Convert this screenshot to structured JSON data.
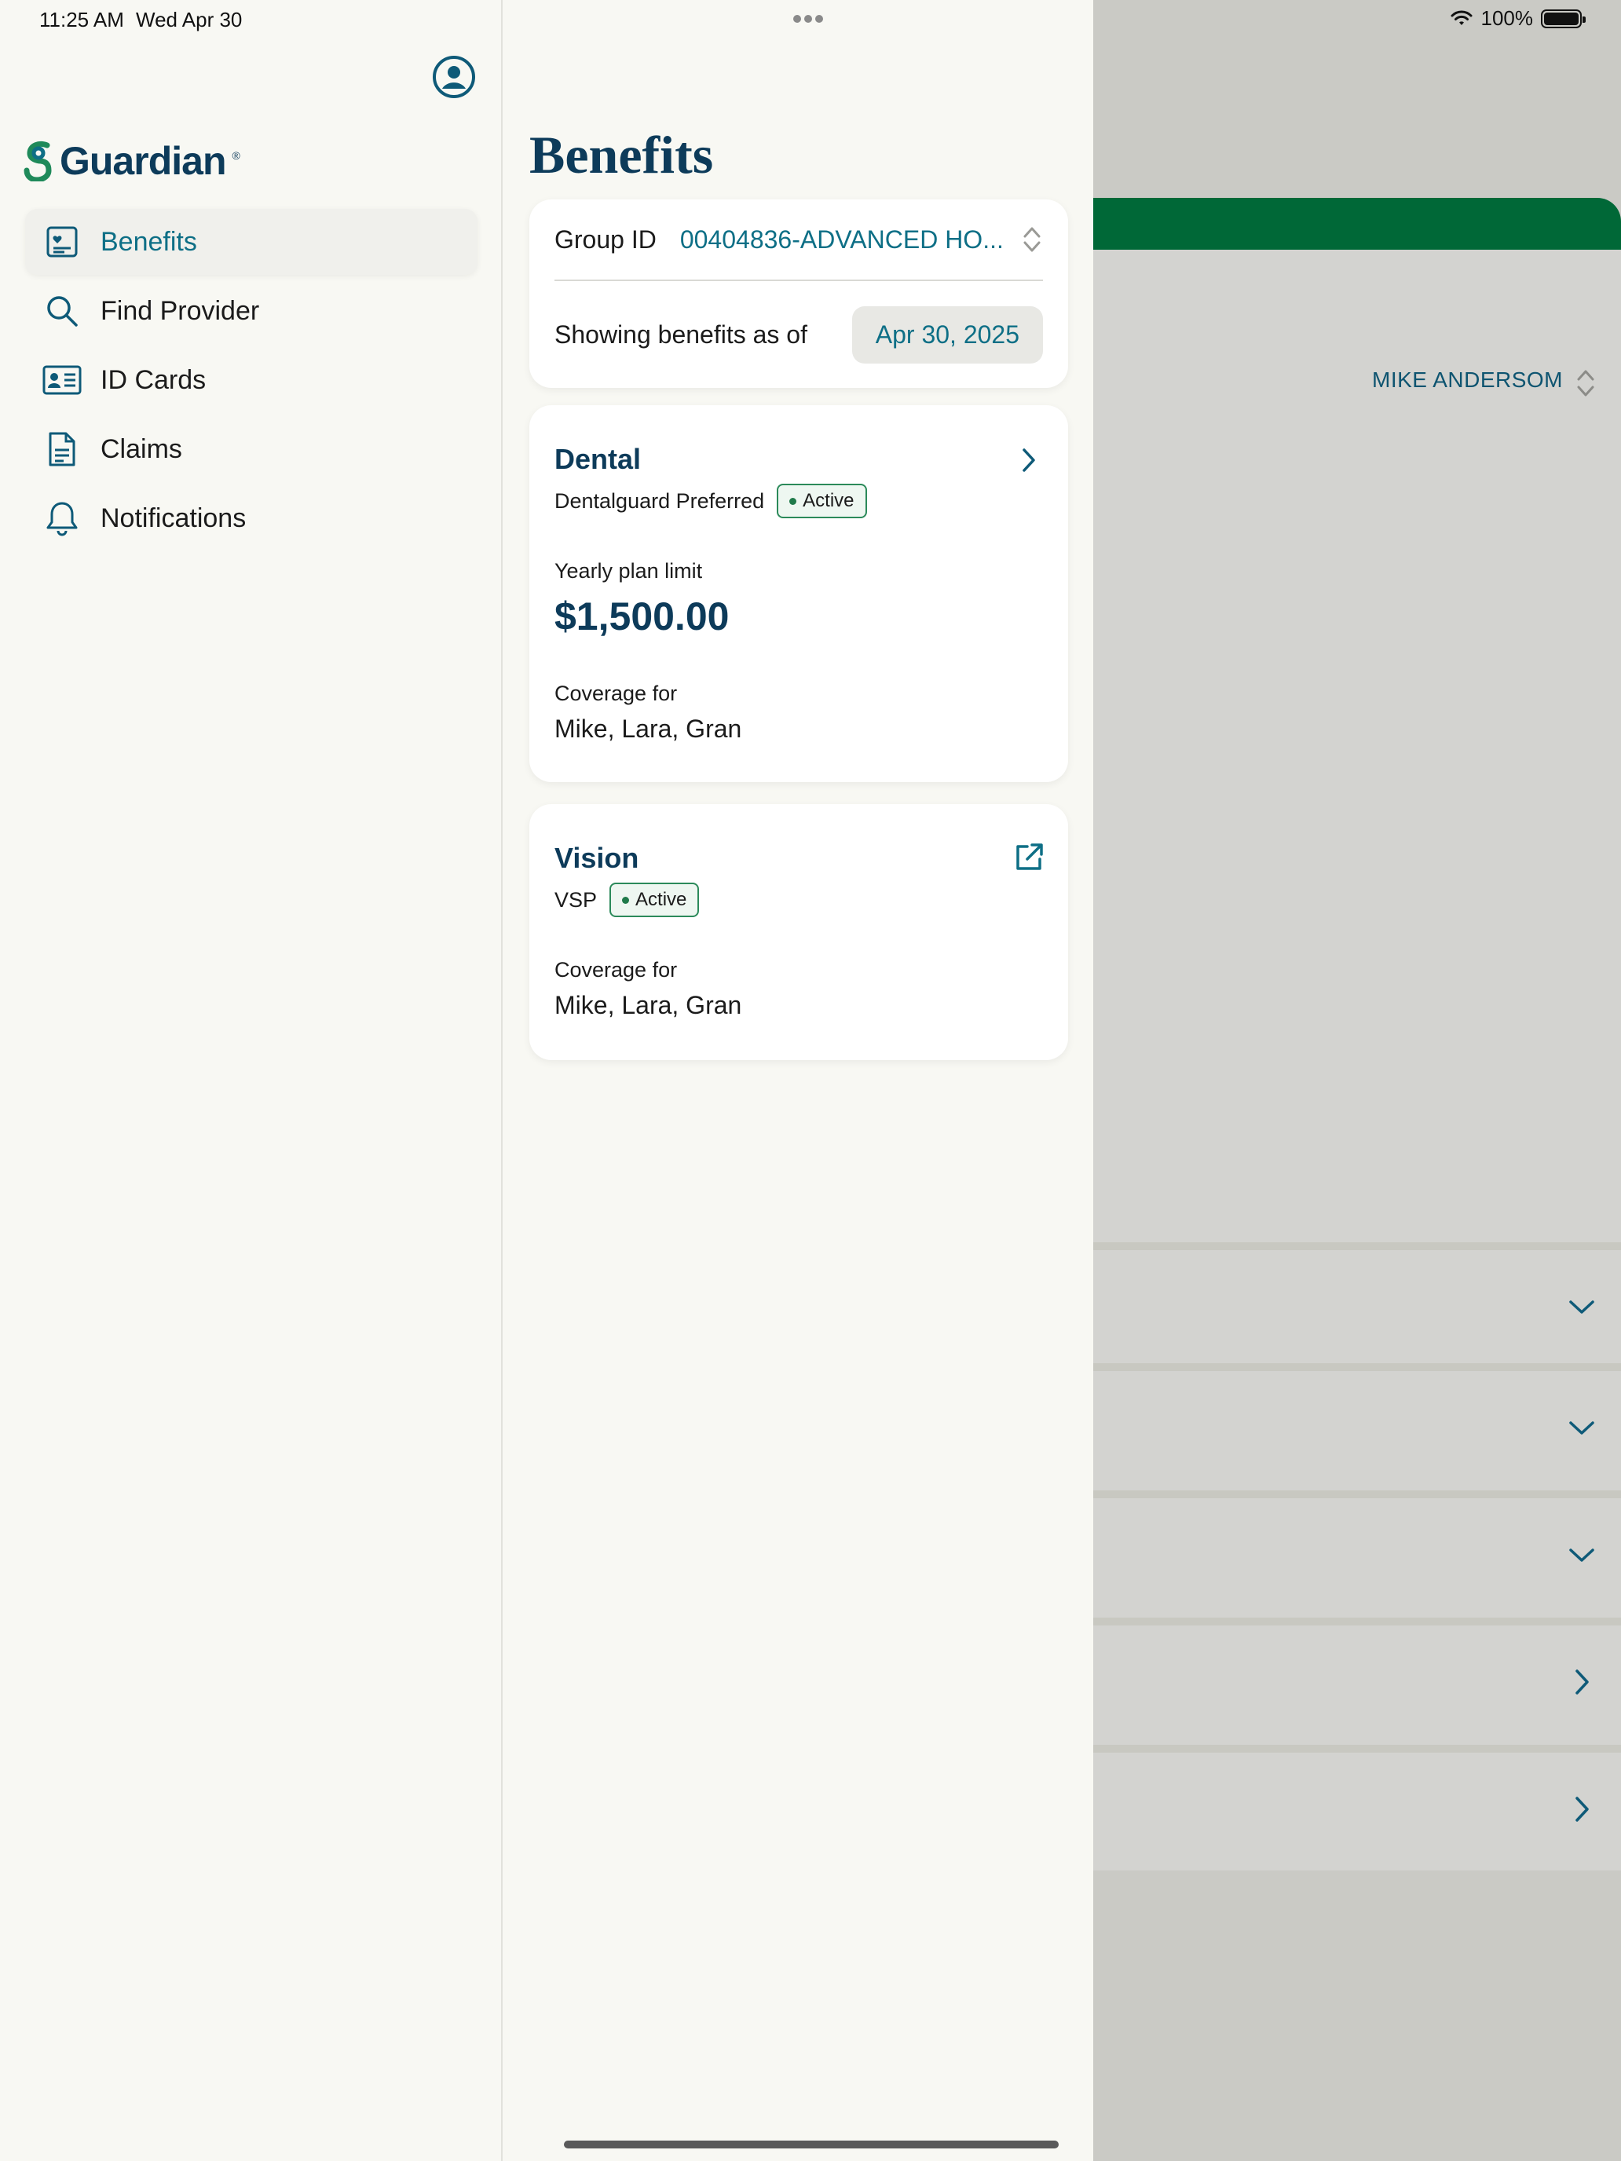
{
  "status_bar": {
    "time": "11:25 AM",
    "date": "Wed Apr 30",
    "battery": "100%"
  },
  "sidebar": {
    "logo_text": "Guardian",
    "logo_mark": "®",
    "items": [
      {
        "label": "Benefits",
        "icon": "benefits-icon",
        "active": true
      },
      {
        "label": "Find Provider",
        "icon": "search-icon",
        "active": false
      },
      {
        "label": "ID Cards",
        "icon": "id-card-icon",
        "active": false
      },
      {
        "label": "Claims",
        "icon": "document-icon",
        "active": false
      },
      {
        "label": "Notifications",
        "icon": "bell-icon",
        "active": false
      }
    ]
  },
  "benefits": {
    "title": "Benefits",
    "group_label": "Group ID",
    "group_value": "00404836-ADVANCED HO...",
    "asof_label": "Showing benefits as of",
    "asof_date": "Apr 30, 2025",
    "dental": {
      "title": "Dental",
      "plan": "Dentalguard Preferred",
      "status": "Active",
      "limit_label": "Yearly plan limit",
      "limit_value": "$1,500.00",
      "coverage_label": "Coverage for",
      "coverage_names": "Mike, Lara, Gran"
    },
    "vision": {
      "title": "Vision",
      "plan": "VSP",
      "status": "Active",
      "coverage_label": "Coverage for",
      "coverage_names": "Mike, Lara, Gran"
    }
  },
  "background_panel": {
    "member_name": "MIKE ANDERSOM"
  },
  "colors": {
    "brand_navy": "#0d3b5a",
    "accent_teal": "#0e6f86",
    "brand_green": "#006837",
    "active_badge": "#2b8a5a"
  }
}
